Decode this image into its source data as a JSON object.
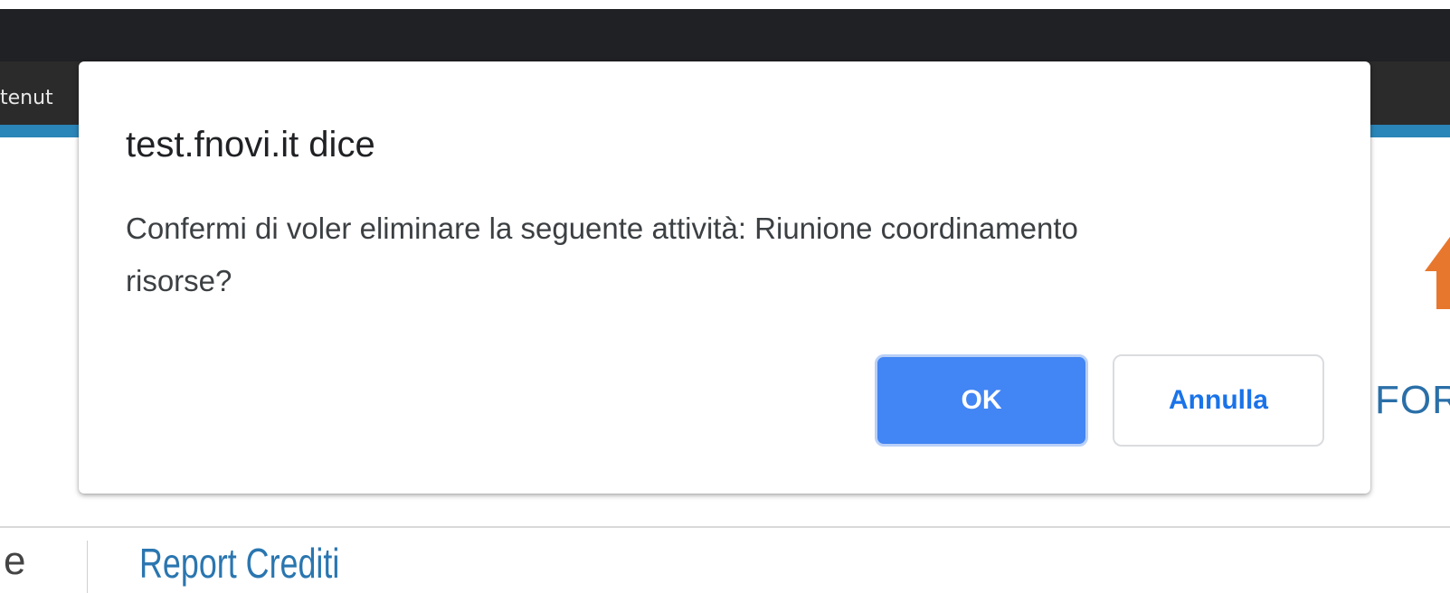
{
  "background_page": {
    "header_text": "tenut",
    "partial_heading": "FOR",
    "sidebar_fragment": "e",
    "report_title": "Report Crediti"
  },
  "dialog": {
    "title": "test.fnovi.it dice",
    "message": "Confermi di voler eliminare la seguente attività: Riunione coordinamento risorse?",
    "ok_label": "OK",
    "cancel_label": "Annulla"
  },
  "colors": {
    "ok_button": "#4285f4",
    "cancel_text": "#1a73e8",
    "header_accent": "#2a85b8",
    "logo_accent": "#e8772e"
  }
}
